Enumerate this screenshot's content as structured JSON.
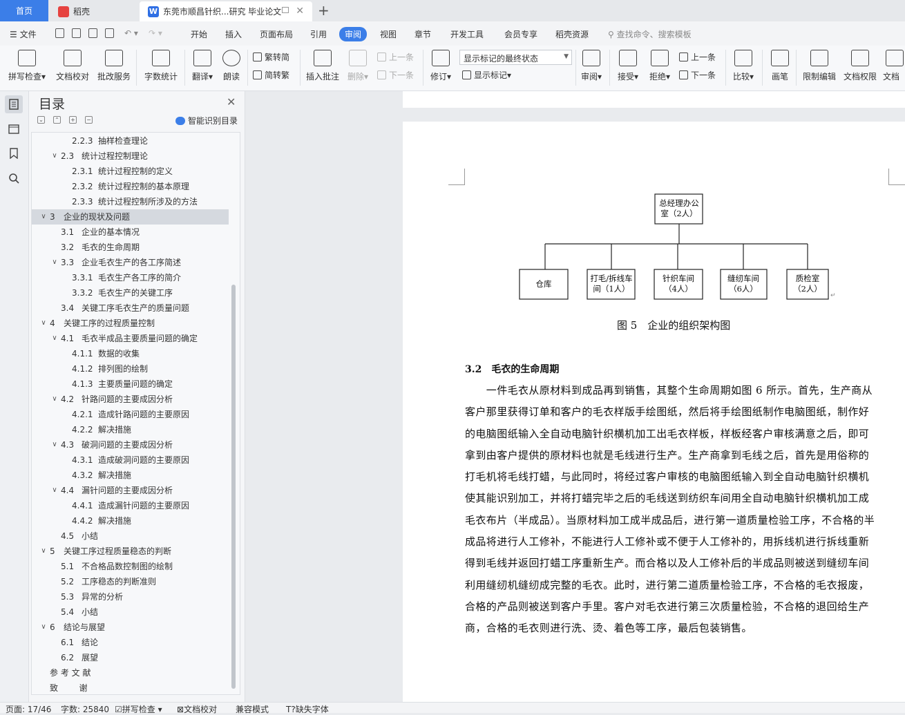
{
  "tabs": {
    "home": "首页",
    "daoke": "稻壳",
    "doc": "东莞市顺昌针织...研究 毕业论文",
    "doc_icon": "W"
  },
  "menu": {
    "file": "文件",
    "items": [
      "开始",
      "插入",
      "页面布局",
      "引用",
      "审阅",
      "视图",
      "章节",
      "开发工具",
      "会员专享",
      "稻壳资源"
    ],
    "search": "查找命令、搜索模板"
  },
  "ribbon": {
    "spellcheck": "拼写检查",
    "doc_proof": "文档校对",
    "batch_service": "批改服务",
    "word_count": "字数统计",
    "translate": "翻译",
    "read_aloud": "朗读",
    "trad": "繁转简",
    "simp": "简转繁",
    "insert_comment": "插入批注",
    "delete": "删除",
    "prev_comment": "上一条",
    "next_comment": "下一条",
    "revise": "修订",
    "markup_combo": "显示标记的最终状态",
    "show_markup": "显示标记",
    "review": "审阅",
    "accept": "接受",
    "reject": "拒绝",
    "prev": "上一条",
    "next": "下一条",
    "compare": "比较",
    "pen": "画笔",
    "restrict": "限制编辑",
    "doc_rights": "文档权限",
    "doc_final": "文档"
  },
  "nav": {
    "title": "目录",
    "smart": "智能识别目录",
    "toc": [
      {
        "num": "2.2.3",
        "text": "抽样检查理论",
        "level": 3
      },
      {
        "num": "2.3",
        "text": "统计过程控制理论",
        "level": 2,
        "toggle": true
      },
      {
        "num": "2.3.1",
        "text": "统计过程控制的定义",
        "level": 3
      },
      {
        "num": "2.3.2",
        "text": "统计过程控制的基本原理",
        "level": 3
      },
      {
        "num": "2.3.3",
        "text": "统计过程控制所涉及的方法",
        "level": 3
      },
      {
        "num": "3",
        "text": "企业的现状及问题",
        "level": 1,
        "toggle": true,
        "selected": true
      },
      {
        "num": "3.1",
        "text": "企业的基本情况",
        "level": 2
      },
      {
        "num": "3.2",
        "text": "毛衣的生命周期",
        "level": 2
      },
      {
        "num": "3.3",
        "text": "企业毛衣生产的各工序简述",
        "level": 2,
        "toggle": true
      },
      {
        "num": "3.3.1",
        "text": "毛衣生产各工序的简介",
        "level": 3
      },
      {
        "num": "3.3.2",
        "text": "毛衣生产的关键工序",
        "level": 3
      },
      {
        "num": "3.4",
        "text": "关键工序毛衣生产的质量问题",
        "level": 2
      },
      {
        "num": "4",
        "text": "关键工序的过程质量控制",
        "level": 1,
        "toggle": true
      },
      {
        "num": "4.1",
        "text": "毛衣半成品主要质量问题的确定",
        "level": 2,
        "toggle": true
      },
      {
        "num": "4.1.1",
        "text": "数据的收集",
        "level": 3
      },
      {
        "num": "4.1.2",
        "text": "排列图的绘制",
        "level": 3
      },
      {
        "num": "4.1.3",
        "text": "主要质量问题的确定",
        "level": 3
      },
      {
        "num": "4.2",
        "text": "针路问题的主要成因分析",
        "level": 2,
        "toggle": true
      },
      {
        "num": "4.2.1",
        "text": "造成针路问题的主要原因",
        "level": 3
      },
      {
        "num": "4.2.2",
        "text": "解决措施",
        "level": 3
      },
      {
        "num": "4.3",
        "text": "破洞问题的主要成因分析",
        "level": 2,
        "toggle": true
      },
      {
        "num": "4.3.1",
        "text": "造成破洞问题的主要原因",
        "level": 3
      },
      {
        "num": "4.3.2",
        "text": "解决措施",
        "level": 3
      },
      {
        "num": "4.4",
        "text": "漏针问题的主要成因分析",
        "level": 2,
        "toggle": true
      },
      {
        "num": "4.4.1",
        "text": "造成漏针问题的主要原因",
        "level": 3
      },
      {
        "num": "4.4.2",
        "text": "解决措施",
        "level": 3
      },
      {
        "num": "4.5",
        "text": "小结",
        "level": 2
      },
      {
        "num": "5",
        "text": "关键工序过程质量稳态的判断",
        "level": 1,
        "toggle": true
      },
      {
        "num": "5.1",
        "text": "不合格品数控制图的绘制",
        "level": 2
      },
      {
        "num": "5.2",
        "text": "工序稳态的判断准则",
        "level": 2
      },
      {
        "num": "5.3",
        "text": "异常的分析",
        "level": 2
      },
      {
        "num": "5.4",
        "text": "小结",
        "level": 2
      },
      {
        "num": "6",
        "text": "结论与展望",
        "level": 1,
        "toggle": true
      },
      {
        "num": "6.1",
        "text": "结论",
        "level": 2
      },
      {
        "num": "6.2",
        "text": "展望",
        "level": 2
      },
      {
        "num": "",
        "text": "参 考 文 献",
        "level": 0
      },
      {
        "num": "",
        "text": "致        谢",
        "level": 0
      }
    ]
  },
  "document": {
    "org": {
      "top": [
        "总经理办公",
        "室（2人）"
      ],
      "children": [
        [
          "仓库"
        ],
        [
          "打毛/拆线车",
          "间（1人）"
        ],
        [
          "针织车间",
          "（4人）"
        ],
        [
          "缝纫车间",
          "（6人）"
        ],
        [
          "质检室",
          "（2人）"
        ]
      ]
    },
    "figure_caption": "图 5　企业的组织架构图",
    "section_title": "3.2　毛衣的生命周期",
    "paragraph_lines": [
      "　　一件毛衣从原材料到成品再到销售，其整个生命周期如图 6 所示。首先，生产商从",
      "客户那里获得订单和客户的毛衣样版手绘图纸，然后将手绘图纸制作电脑图纸，制作好",
      "的电脑图纸输入全自动电脑针织横机加工出毛衣样板，样板经客户审核满意之后，即可",
      "拿到由客户提供的原材料也就是毛线进行生产。生产商拿到毛线之后，首先是用俗称的",
      "打毛机将毛线打蜡，与此同时，将经过客户审核的电脑图纸输入到全自动电脑针织横机",
      "使其能识别加工，并将打蜡完毕之后的毛线送到纺织车间用全自动电脑针织横机加工成",
      "毛衣布片（半成品）。当原材料加工成半成品后，进行第一道质量检验工序，不合格的半",
      "成品将进行人工修补，不能进行人工修补或不便于人工修补的，用拆线机进行拆线重新",
      "得到毛线并返回打蜡工序重新生产。而合格以及人工修补后的半成品则被送到缝纫车间",
      "利用缝纫机缝纫成完整的毛衣。此时，进行第二道质量检验工序，不合格的毛衣报废，",
      "合格的产品则被送到客户手里。客户对毛衣进行第三次质量检验，不合格的退回给生产",
      "商，合格的毛衣则进行洗、烫、着色等工序，最后包装销售。"
    ]
  },
  "status": {
    "page": "页面: 17/46",
    "words": "字数: 25840",
    "spell": "拼写检查",
    "proof": "文档校对",
    "compat": "兼容模式",
    "missing_font": "缺失字体"
  }
}
